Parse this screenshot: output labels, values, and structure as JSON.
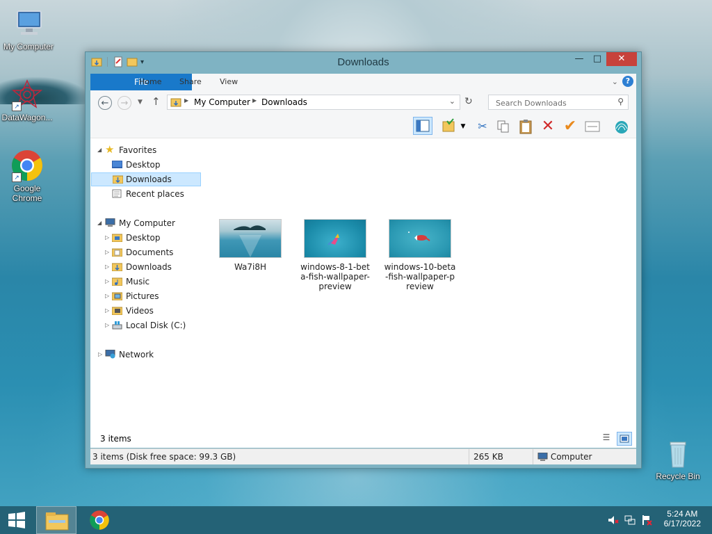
{
  "desktop": {
    "icons": [
      {
        "label": "My Computer"
      },
      {
        "label": "DataWagon..."
      },
      {
        "label": "Google Chrome"
      },
      {
        "label": "Recycle Bin"
      }
    ]
  },
  "window": {
    "title": "Downloads",
    "tabs": [
      "File",
      "Home",
      "Share",
      "View"
    ],
    "address": {
      "root": "My Computer",
      "current": "Downloads"
    },
    "search_placeholder": "Search Downloads"
  },
  "navpane": {
    "favorites_header": "Favorites",
    "favorites": [
      "Desktop",
      "Downloads",
      "Recent places"
    ],
    "computer_header": "My Computer",
    "computer_items": [
      "Desktop",
      "Documents",
      "Downloads",
      "Music",
      "Pictures",
      "Videos",
      "Local Disk (C:)"
    ],
    "network": "Network",
    "selected": "Downloads"
  },
  "files": [
    {
      "name": "Wa7i8H",
      "lines": [
        "Wa7i8H"
      ]
    },
    {
      "name": "windows-8-1-beta-fish-wallpaper-preview",
      "lines": [
        "windows-8-1-bet",
        "a-fish-wallpaper-",
        "preview"
      ]
    },
    {
      "name": "windows-10-beta-fish-wallpaper-preview",
      "lines": [
        "windows-10-beta",
        "-fish-wallpaper-p",
        "review"
      ]
    }
  ],
  "status": {
    "item_count": "3 items",
    "details": "3 items (Disk free space: 99.3 GB)",
    "size": "265 KB",
    "location": "Computer"
  },
  "taskbar": {
    "time": "5:24 AM",
    "date": "6/17/2022"
  }
}
